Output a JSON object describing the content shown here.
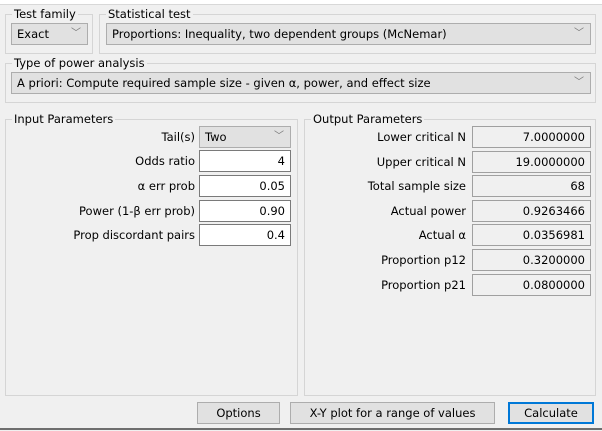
{
  "test_family": {
    "label": "Test family",
    "value": "Exact"
  },
  "statistical_test": {
    "label": "Statistical test",
    "value": "Proportions: Inequality, two dependent groups (McNemar)"
  },
  "power_analysis": {
    "label": "Type of power analysis",
    "value": "A priori: Compute required sample size - given α, power, and effect size"
  },
  "input": {
    "title": "Input Parameters",
    "rows": [
      {
        "label": "Tail(s)",
        "value": "Two"
      },
      {
        "label": "Odds ratio",
        "value": "4"
      },
      {
        "label": "α err prob",
        "value": "0.05"
      },
      {
        "label": "Power (1-β err prob)",
        "value": "0.90"
      },
      {
        "label": "Prop discordant pairs",
        "value": "0.4"
      }
    ]
  },
  "output": {
    "title": "Output Parameters",
    "rows": [
      {
        "label": "Lower critical N",
        "value": "7.0000000"
      },
      {
        "label": "Upper critical N",
        "value": "19.0000000"
      },
      {
        "label": "Total sample size",
        "value": "68"
      },
      {
        "label": "Actual power",
        "value": "0.9263466"
      },
      {
        "label": "Actual α",
        "value": "0.0356981"
      },
      {
        "label": "Proportion p12",
        "value": "0.3200000"
      },
      {
        "label": "Proportion p21",
        "value": "0.0800000"
      }
    ]
  },
  "buttons": {
    "options": "Options",
    "xy_plot": "X-Y plot for a range of values",
    "calculate": "Calculate"
  },
  "icons": {
    "dropdown": "chevron-down-icon"
  },
  "colors": {
    "accent": "#0078d7"
  }
}
